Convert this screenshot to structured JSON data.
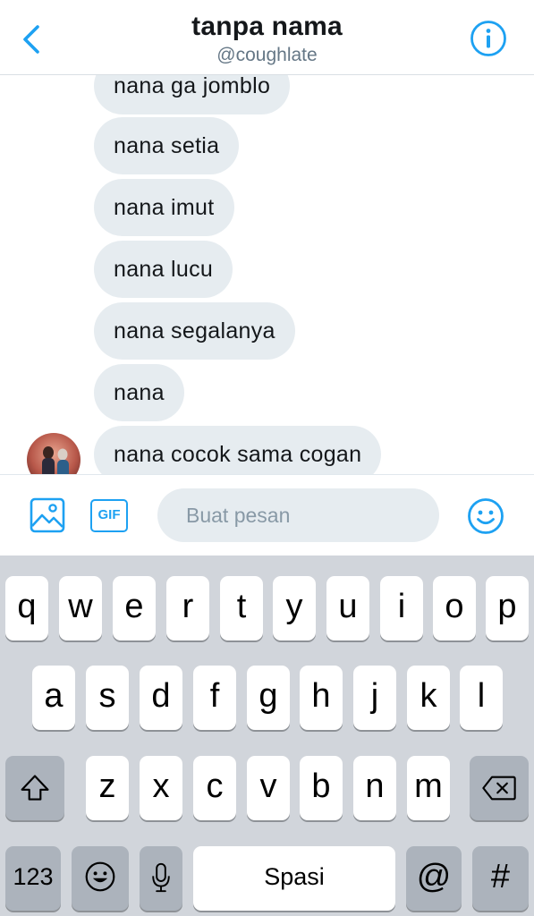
{
  "header": {
    "title": "tanpa nama",
    "handle": "@coughlate"
  },
  "messages": [
    "nana ga jomblo",
    "nana setia",
    "nana imut",
    "nana lucu",
    "nana segalanya",
    "nana",
    "nana cocok sama cogan"
  ],
  "composer": {
    "gif_label": "GIF",
    "placeholder": "Buat pesan"
  },
  "keyboard": {
    "row1": [
      "q",
      "w",
      "e",
      "r",
      "t",
      "y",
      "u",
      "i",
      "o",
      "p"
    ],
    "row2": [
      "a",
      "s",
      "d",
      "f",
      "g",
      "h",
      "j",
      "k",
      "l"
    ],
    "row3": [
      "z",
      "x",
      "c",
      "v",
      "b",
      "n",
      "m"
    ],
    "numbers_key": "123",
    "space_key": "Spasi",
    "at_key": "@",
    "hash_key": "#"
  },
  "colors": {
    "accent": "#1da1f2",
    "bubble": "#e6ecf0",
    "keyboard_bg": "#d1d5db",
    "dark_key": "#acb3bc"
  }
}
